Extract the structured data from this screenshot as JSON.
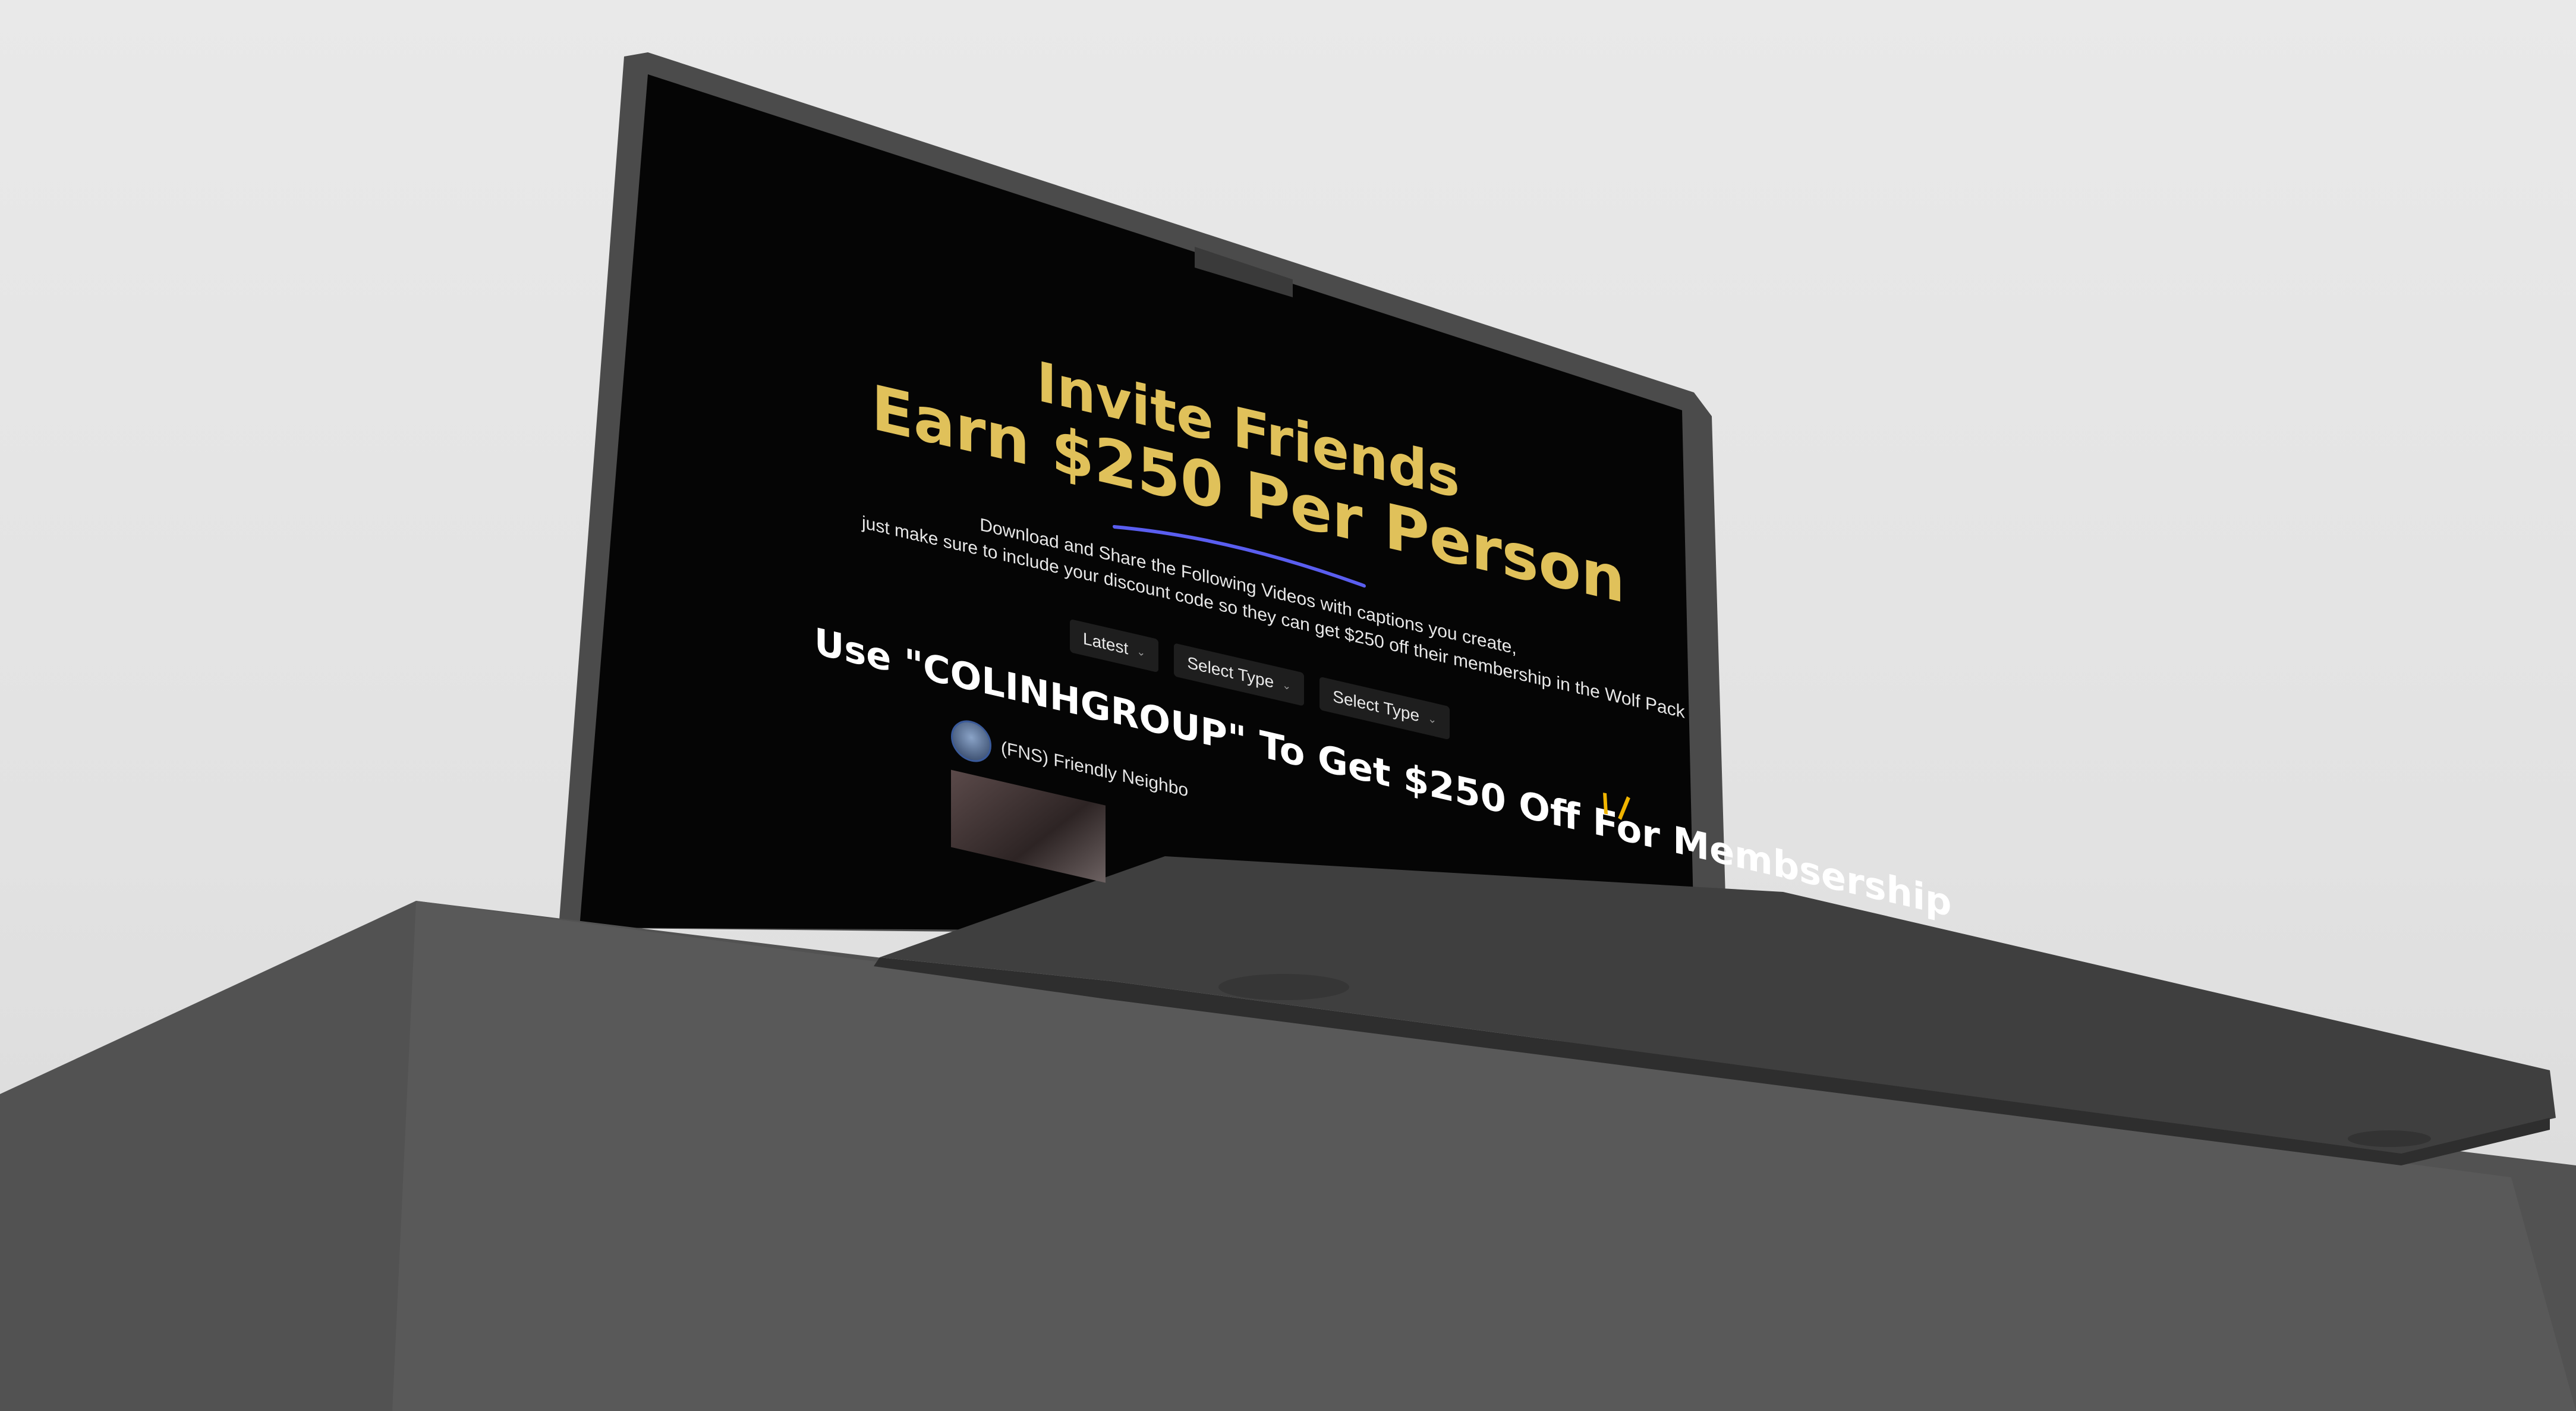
{
  "page": {
    "hero": {
      "line1": "Invite Friends",
      "line2": "Earn $250 Per Person"
    },
    "description": {
      "line1": "Download and Share the Following Videos with captions you create,",
      "line2": "just make sure to include your discount code so they can get $250 off their membership in the Wolf Pack"
    },
    "filters": [
      {
        "label": "Latest"
      },
      {
        "label": "Select Type"
      },
      {
        "label": "Select Type"
      }
    ],
    "promo": "Use \"COLINHGROUP\" To Get $250 Off For Membsership",
    "video": {
      "channel": "(FNS) Friendly Neighbo"
    }
  },
  "colors": {
    "gold": "#e0c15a",
    "underline": "#5a5ef0",
    "screen_bg": "#050505",
    "laptop_body": "#4a4a4a",
    "wall": "#e6e6e6"
  }
}
